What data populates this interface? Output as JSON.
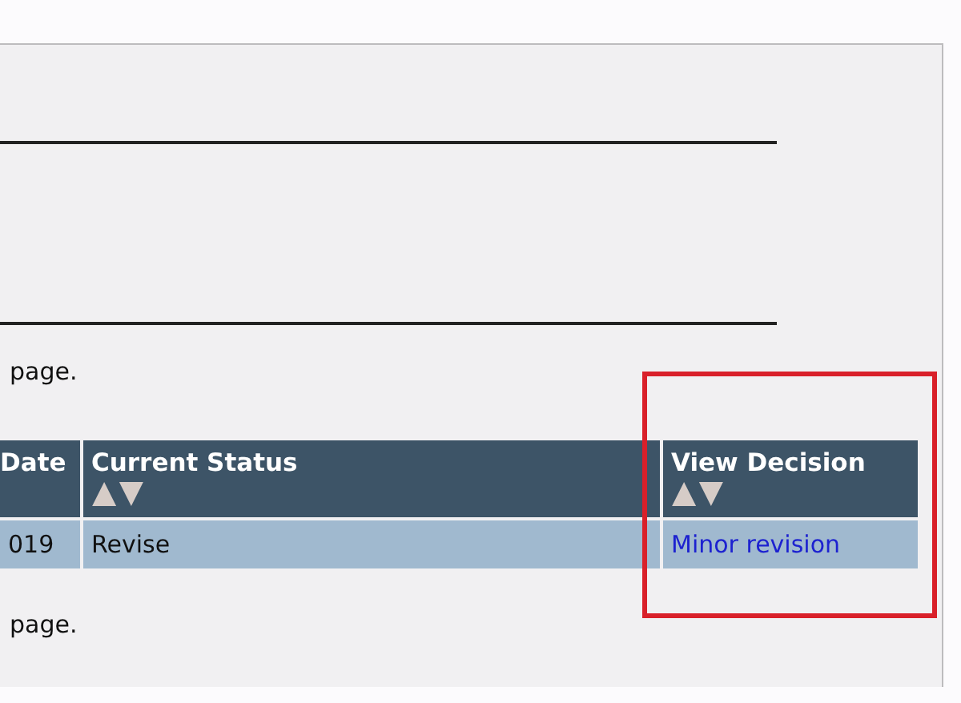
{
  "notes": [
    "page.",
    "page."
  ],
  "table": {
    "columns": [
      {
        "label": "Date",
        "sortable": false,
        "highlighted": false
      },
      {
        "label": "Current Status",
        "sortable": true,
        "highlighted": false
      },
      {
        "label": "View Decision",
        "sortable": true,
        "highlighted": true
      }
    ],
    "rows": [
      {
        "cells": [
          {
            "kind": "text",
            "text": "019"
          },
          {
            "kind": "text",
            "text": "Revise"
          },
          {
            "kind": "link",
            "text": "Minor revision"
          }
        ]
      }
    ]
  }
}
